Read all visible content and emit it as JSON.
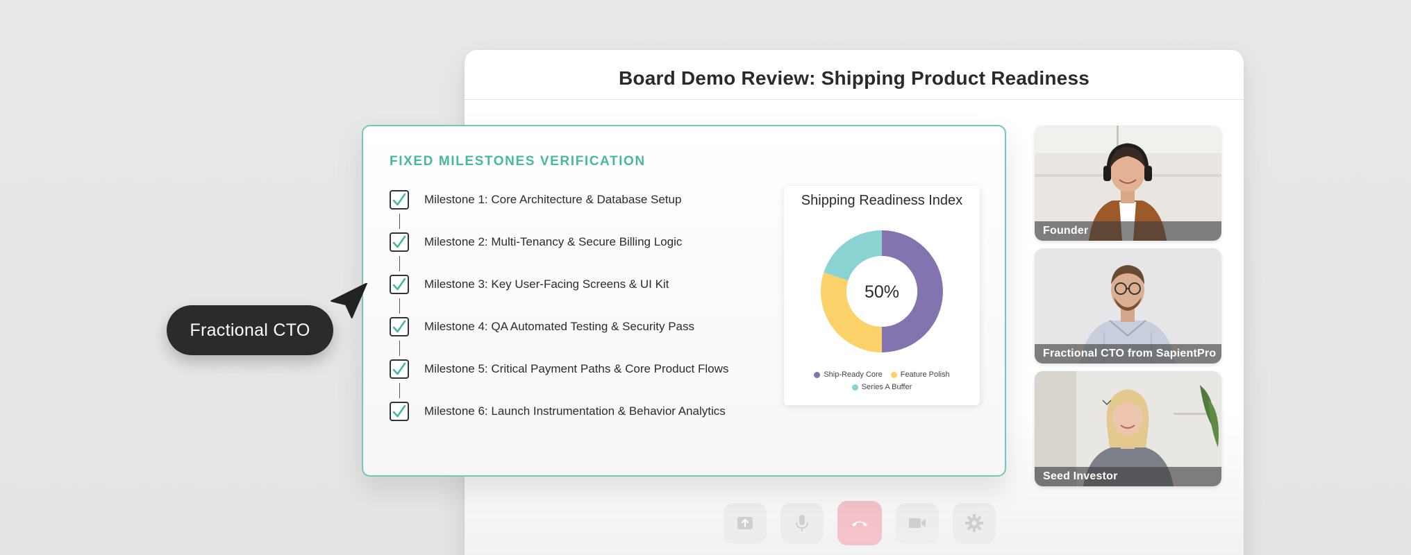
{
  "call": {
    "title": "Board Demo Review: Shipping Product Readiness"
  },
  "slide": {
    "heading": "FIXED MILESTONES VERIFICATION",
    "milestones": [
      {
        "label": "Milestone 1: Core Architecture & Database Setup",
        "checked": true
      },
      {
        "label": "Milestone 2: Multi-Tenancy & Secure Billing Logic",
        "checked": true
      },
      {
        "label": "Milestone 3: Key User-Facing Screens & UI Kit",
        "checked": true
      },
      {
        "label": "Milestone 4: QA Automated Testing & Security Pass",
        "checked": true
      },
      {
        "label": "Milestone 5: Critical Payment Paths & Core Product Flows",
        "checked": true
      },
      {
        "label": "Milestone 6: Launch Instrumentation & Behavior Analytics",
        "checked": true
      }
    ]
  },
  "chart_data": {
    "type": "pie",
    "title": "Shipping Readiness Index",
    "center_label": "50%",
    "series": [
      {
        "name": "Ship-Ready Core",
        "value": 50,
        "color": "#8374b0"
      },
      {
        "name": "Feature Polish",
        "value": 30,
        "color": "#fbd16a"
      },
      {
        "name": "Series A Buffer",
        "value": 20,
        "color": "#8ad3d3"
      }
    ],
    "legend_placement": "bottom"
  },
  "participants": [
    {
      "name": "Founder"
    },
    {
      "name": "Fractional CTO from SapientPro"
    },
    {
      "name": "Seed Investor"
    }
  ],
  "pointer_label": "Fractional CTO",
  "controls": [
    {
      "name": "share-screen",
      "icon": "share-screen-icon"
    },
    {
      "name": "microphone",
      "icon": "microphone-icon"
    },
    {
      "name": "end-call",
      "icon": "hang-up-icon",
      "color": "#e5707f"
    },
    {
      "name": "camera",
      "icon": "video-camera-icon"
    },
    {
      "name": "settings",
      "icon": "gear-icon"
    }
  ],
  "colors": {
    "accent": "#47b8a0",
    "slide_border": "#6fc9b6",
    "pill_bg": "#2b2b2b"
  }
}
